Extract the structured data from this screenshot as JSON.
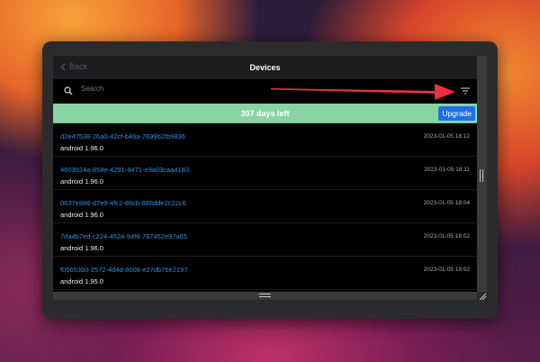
{
  "header": {
    "back_label": "Back",
    "title": "Devices"
  },
  "search": {
    "placeholder": "Search"
  },
  "banner": {
    "text": "307 days left",
    "upgrade_label": "Upgrade",
    "color": "#88d4a4"
  },
  "devices": [
    {
      "id": "d2e47538-26a0-42cf-b46a-7699b2fb9836",
      "version": "android 1.96.0",
      "timestamp": "2023-01-05 18:12"
    },
    {
      "id": "4603024a-858e-4291-8471-e9a03caa4183",
      "version": "android 1.96.0",
      "timestamp": "2023-01-05 18:11"
    },
    {
      "id": "0637e886-d7e9-4fc2-85cb-888dde2c22c6",
      "version": "android 1.96.0",
      "timestamp": "2023-01-05 18:04"
    },
    {
      "id": "7da4b7ed-c224-4524-94f6-767452e97a65",
      "version": "android 1.96.0",
      "timestamp": "2023-01-05 18:02"
    },
    {
      "id": "f05653b0-2572-4d4d-8008-e27db7be2197",
      "version": "android 1.95.0",
      "timestamp": "2023-01-05 18:02"
    }
  ]
}
